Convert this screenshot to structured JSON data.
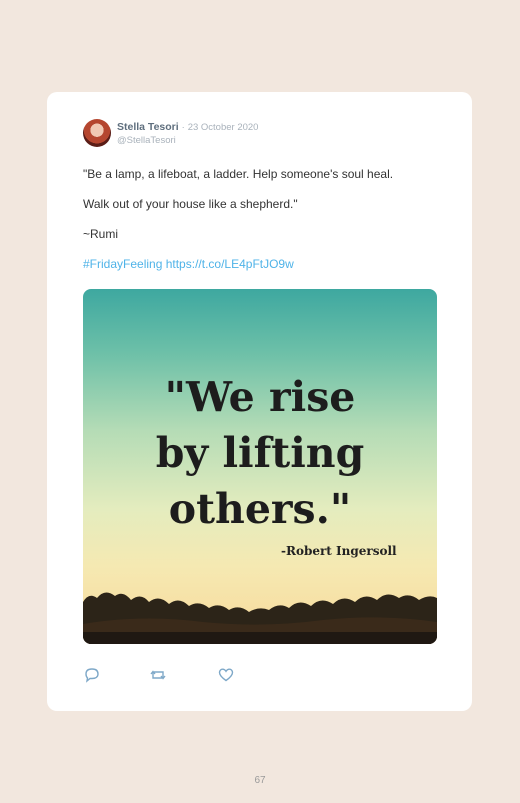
{
  "tweet": {
    "author_name": "Stella Tesori",
    "separator": "·",
    "date": "23 October 2020",
    "handle": "@StellaTesori",
    "line1": "\"Be a lamp, a lifeboat, a ladder. Help someone's soul heal.",
    "line2": "Walk out of your house like a shepherd.\"",
    "line3": "~Rumi",
    "hashtag": "#FridayFeeling",
    "link": "https://t.co/LE4pFtJO9w"
  },
  "media": {
    "quote_line1": "\"We rise",
    "quote_line2": "by lifting",
    "quote_line3": "others.\"",
    "attribution": "-Robert Ingersoll"
  },
  "actions": {
    "icons": [
      "reply-icon",
      "retweet-icon",
      "like-icon"
    ]
  },
  "footer": {
    "page_number": "67"
  },
  "colors": {
    "page_background": "#f2e7de",
    "link": "#4fb3e8",
    "icon": "#7ea8c8"
  }
}
